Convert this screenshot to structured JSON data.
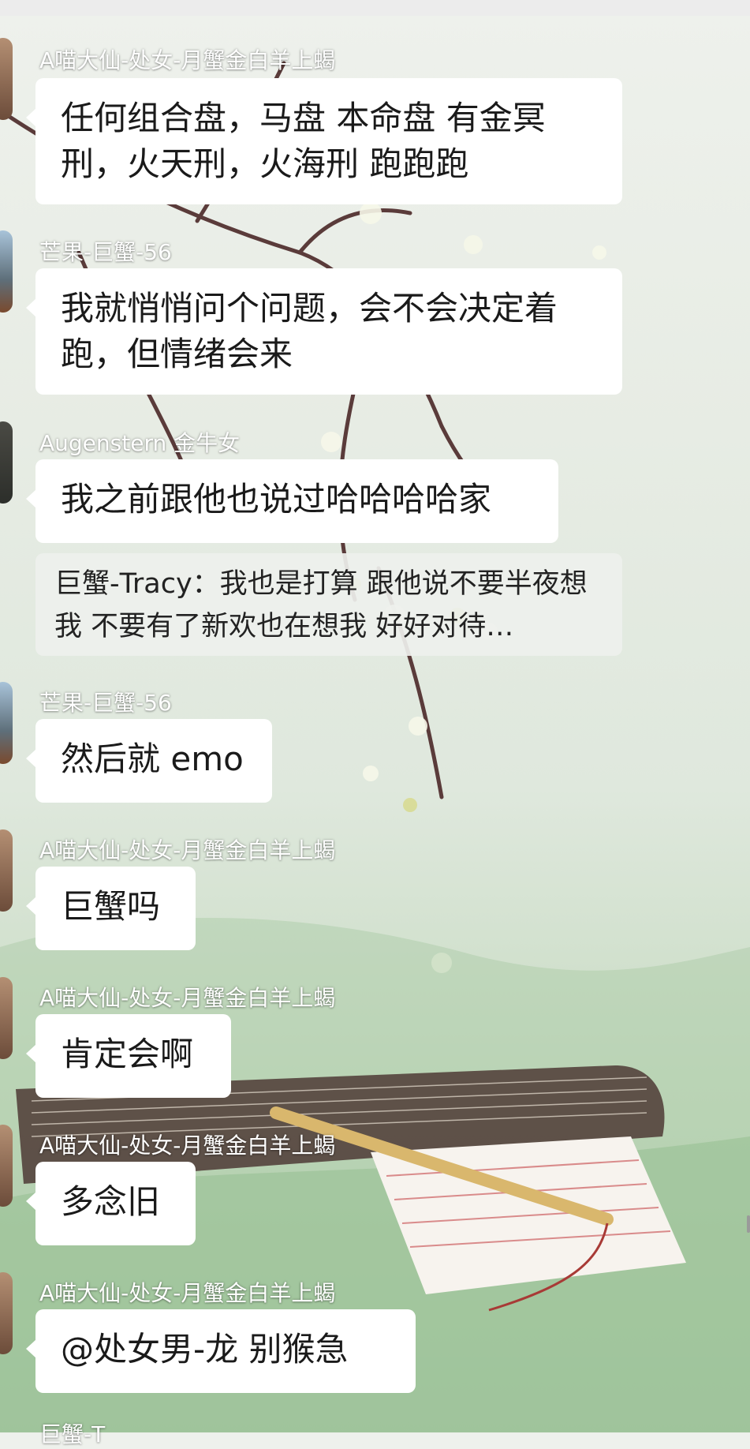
{
  "messages": [
    {
      "sender": "A喵大仙-处女-月蟹金白羊上蝎",
      "text": "任何组合盘，马盘 本命盘 有金冥刑，火天刑，火海刑 跑跑跑"
    },
    {
      "sender": "芒果-巨蟹-56",
      "text": "我就悄悄问个问题，会不会决定着跑，但情绪会来"
    },
    {
      "sender": "Augenstern 金牛女",
      "text": "我之前跟他也说过哈哈哈哈家",
      "quote": "巨蟹-Tracy：我也是打算 跟他说不要半夜想我 不要有了新欢也在想我 好好对待…"
    },
    {
      "sender": "芒果-巨蟹-56",
      "text": "然后就 emo"
    },
    {
      "sender": "A喵大仙-处女-月蟹金白羊上蝎",
      "text": "巨蟹吗"
    },
    {
      "sender": "A喵大仙-处女-月蟹金白羊上蝎",
      "text": "肯定会啊"
    },
    {
      "sender": "A喵大仙-处女-月蟹金白羊上蝎",
      "text": "多念旧"
    },
    {
      "sender": "A喵大仙-处女-月蟹金白羊上蝎",
      "text": "@处女男-龙  别猴急"
    },
    {
      "sender": "巨蟹-T",
      "text": ""
    }
  ]
}
